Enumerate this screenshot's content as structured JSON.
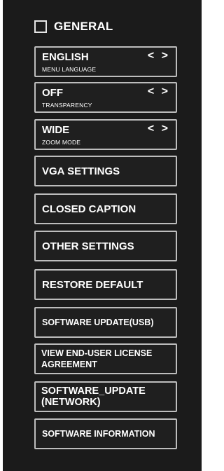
{
  "section": {
    "title": "GENERAL"
  },
  "settings": [
    {
      "value": "ENGLISH",
      "label": "MENU LANGUAGE",
      "arrows": "< >"
    },
    {
      "value": "OFF",
      "label": "TRANSPARENCY",
      "arrows": "< >"
    },
    {
      "value": "WIDE",
      "label": "ZOOM MODE",
      "arrows": "< >"
    }
  ],
  "menu": [
    {
      "label": "VGA SETTINGS"
    },
    {
      "label": "CLOSED CAPTION"
    },
    {
      "label": "OTHER SETTINGS"
    },
    {
      "label": "RESTORE DEFAULT"
    },
    {
      "label": "SOFTWARE UPDATE(USB)"
    },
    {
      "label": "VIEW END-USER LICENSE\nAGREEMENT"
    },
    {
      "label": "SOFTWARE_UPDATE\n(NETWORK)"
    },
    {
      "label": "SOFTWARE INFORMATION"
    }
  ]
}
